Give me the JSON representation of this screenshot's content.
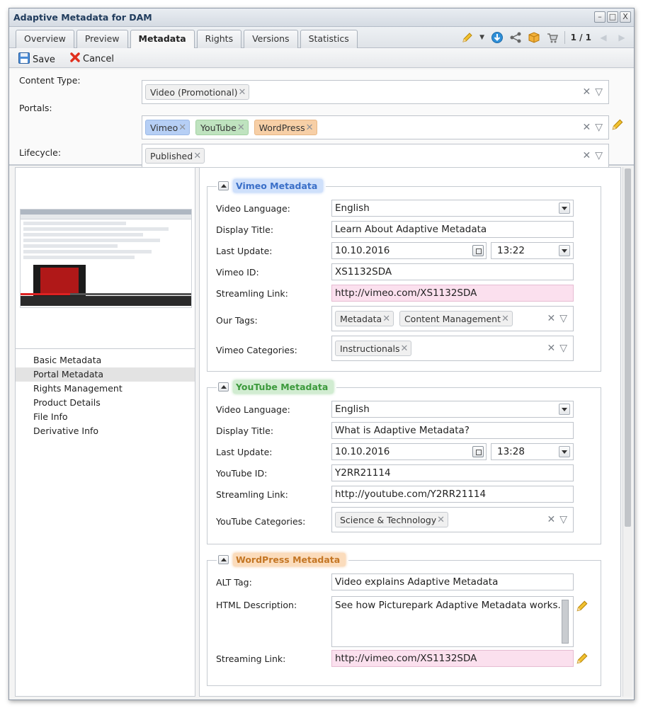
{
  "window": {
    "title": "Adaptive Metadata for DAM",
    "buttons": [
      "–",
      "□",
      "X"
    ]
  },
  "tabs": [
    {
      "label": "Overview"
    },
    {
      "label": "Preview"
    },
    {
      "label": "Metadata",
      "active": true
    },
    {
      "label": "Rights"
    },
    {
      "label": "Versions"
    },
    {
      "label": "Statistics"
    }
  ],
  "tab_tools": {
    "pager": "1 / 1",
    "icons": [
      "pencil-icon",
      "dropdown-arrow-icon",
      "download-icon",
      "share-icon",
      "package-icon",
      "cart-icon",
      "prev-icon",
      "next-icon"
    ]
  },
  "toolbar": {
    "save_label": "Save",
    "cancel_label": "Cancel"
  },
  "top_fields": {
    "content_type": {
      "label": "Content Type:",
      "tags": [
        "Video (Promotional)"
      ]
    },
    "portals": {
      "label": "Portals:",
      "tags": [
        "Vimeo",
        "YouTube",
        "WordPress"
      ]
    },
    "lifecycle": {
      "label": "Lifecycle:",
      "tags": [
        "Published"
      ]
    },
    "clear_symbol": "✕",
    "dropdown_symbol": "▽"
  },
  "nav": {
    "items": [
      "Basic Metadata",
      "Portal Metadata",
      "Rights Management",
      "Product Details",
      "File Info",
      "Derivative Info"
    ],
    "active_index": 1
  },
  "vimeo": {
    "legend": "Vimeo Metadata",
    "video_language_label": "Video Language:",
    "video_language": "English",
    "display_title_label": "Display Title:",
    "display_title": "Learn About Adaptive Metadata",
    "last_update_label": "Last Update:",
    "last_update_date": "10.10.2016",
    "last_update_time": "13:22",
    "id_label": "Vimeo ID:",
    "id_value": "XS1132SDA",
    "streaming_label": "Streamling Link:",
    "streaming_value": "http://vimeo.com/XS1132SDA",
    "tags_label": "Our Tags:",
    "tags": [
      "Metadata",
      "Content Management"
    ],
    "categories_label": "Vimeo Categories:",
    "categories": [
      "Instructionals"
    ]
  },
  "youtube": {
    "legend": "YouTube Metadata",
    "video_language_label": "Video Language:",
    "video_language": "English",
    "display_title_label": "Display Title:",
    "display_title": "What is Adaptive Metadata?",
    "last_update_label": "Last Update:",
    "last_update_date": "10.10.2016",
    "last_update_time": "13:28",
    "id_label": "YouTube ID:",
    "id_value": "Y2RR21114",
    "streaming_label": "Streamling Link:",
    "streaming_value": "http://youtube.com/Y2RR21114",
    "categories_label": "YouTube Categories:",
    "categories": [
      "Science & Technology"
    ]
  },
  "wordpress": {
    "legend": "WordPress Metadata",
    "alt_label": "ALT Tag:",
    "alt_value": "Video explains Adaptive Metadata",
    "html_label": "HTML Description:",
    "html_value": "See how Picturepark Adaptive Metadata works.",
    "streaming_label": "Streaming Link:",
    "streaming_value": "http://vimeo.com/XS1132SDA"
  },
  "colors": {
    "vimeo": "#b6cff5",
    "youtube": "#bfe3bf",
    "wordpress": "#f7cfa6",
    "streaming_highlight": "#fbe0ee"
  }
}
